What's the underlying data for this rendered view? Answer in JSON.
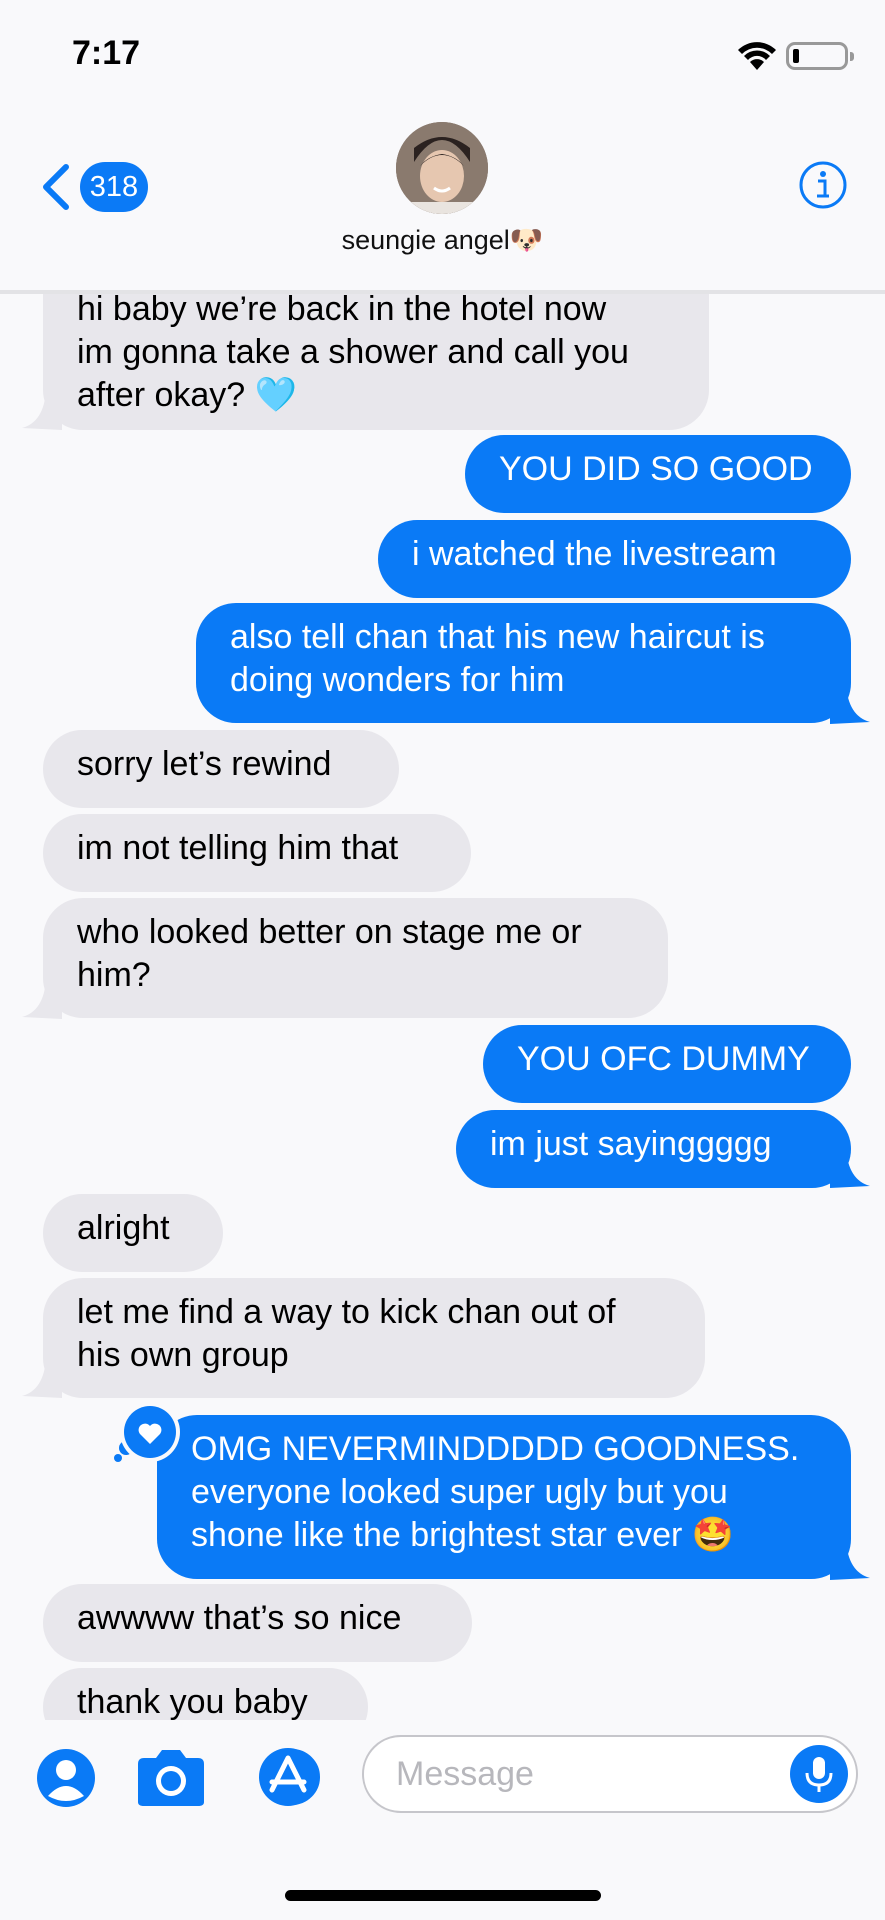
{
  "status": {
    "time": "7:17"
  },
  "header": {
    "unread_count": "318",
    "contact_name": "seungie angel🐶"
  },
  "messages": [
    {
      "dir": "in",
      "text": "hi baby we’re back in the hotel now\nim gonna take a shower and call you\nafter okay? 🩵"
    },
    {
      "dir": "out",
      "text": "YOU DID SO GOOD"
    },
    {
      "dir": "out",
      "text": "i watched the livestream"
    },
    {
      "dir": "out",
      "text": "also tell chan that his new haircut is\ndoing wonders for him"
    },
    {
      "dir": "in",
      "text": "sorry let’s rewind"
    },
    {
      "dir": "in",
      "text": "im not telling him that"
    },
    {
      "dir": "in",
      "text": "who looked better on stage me or\nhim?"
    },
    {
      "dir": "out",
      "text": "YOU OFC DUMMY"
    },
    {
      "dir": "out",
      "text": "im just sayinggggg"
    },
    {
      "dir": "in",
      "text": "alright"
    },
    {
      "dir": "in",
      "text": "let me find a way to kick chan out of\nhis own group"
    },
    {
      "dir": "out",
      "text": "OMG NEVERMINDDDDD GOODNESS.\neveryone looked super ugly but you\nshone like the brightest star ever 🤩",
      "reaction": "heart"
    },
    {
      "dir": "in",
      "text": "awwww that’s so nice"
    },
    {
      "dir": "in",
      "text": "thank you baby"
    }
  ],
  "composer": {
    "placeholder": "Message"
  },
  "colors": {
    "accent": "#0a7af6",
    "incoming": "#e8e7ec"
  }
}
